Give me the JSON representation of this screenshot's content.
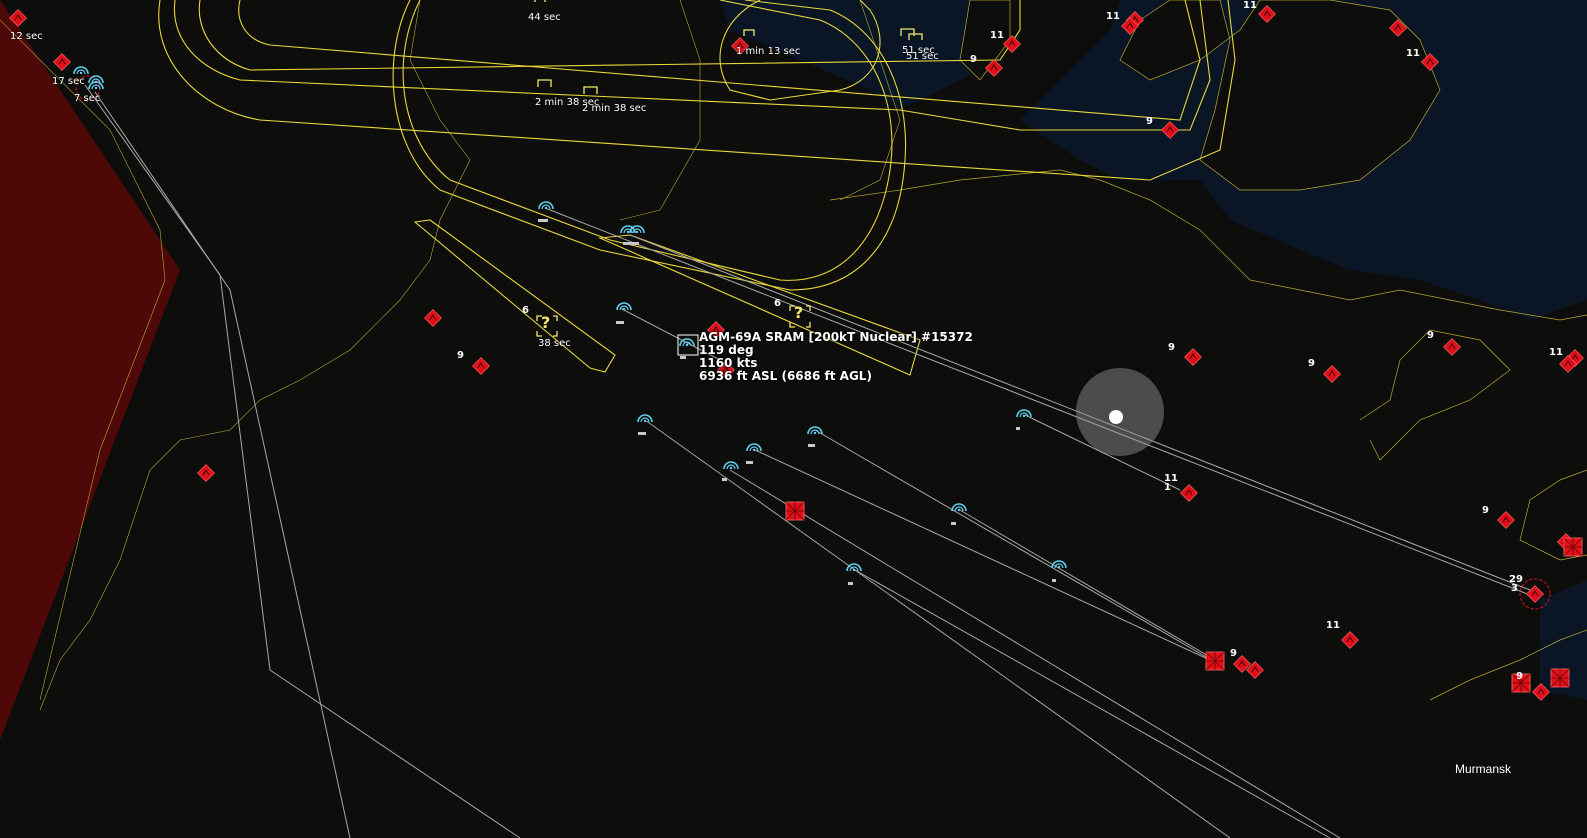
{
  "selected_unit": {
    "name": "AGM-69A SRAM [200kT Nuclear] #15372",
    "heading": "119 deg",
    "speed": "1160 kts",
    "altitude": "6936 ft ASL (6686 ft AGL)"
  },
  "city_label": "Murmansk",
  "time_labels": {
    "t12": "12 sec",
    "t17": "17 sec",
    "t7": "7 sec",
    "t44": "44 sec",
    "t113": "1 min 13 sec",
    "t51a": "51 sec",
    "t51b": "51 sec",
    "t238a": "2 min 38 sec",
    "t238b": "2 min 38 sec",
    "t38": "38 sec"
  },
  "unit_counts": {
    "a": "11",
    "b": "11",
    "c": "11",
    "d": "9",
    "e": "11",
    "f": "9",
    "g": "9",
    "h": "9",
    "i": "9",
    "j": "11",
    "k": "9",
    "l": "9",
    "m": "11",
    "n": "1",
    "o": "29",
    "p": "3",
    "q": "11",
    "r": "9",
    "s": "9",
    "t": "6",
    "u": "6"
  },
  "unknown_marker": "?",
  "colors": {
    "hostile": "#e0101a",
    "missile": "#5fd0f0",
    "range_ring": "#e8d83a",
    "trail": "#a8a8a8",
    "exclusion_zone": "#5a0808",
    "sea": "#0a1526"
  }
}
